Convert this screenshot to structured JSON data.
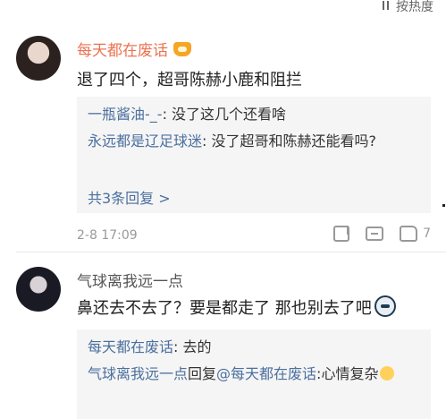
{
  "sort": {
    "label": "按热度"
  },
  "comments": [
    {
      "author": "每天都在废话",
      "text": "退了四个，超哥陈赫小鹿和阻拦",
      "replies": [
        {
          "name": "一瓶酱油-_-",
          "content": ": 没了这几个还看啥"
        },
        {
          "name": "永远都是辽足球迷",
          "content": ": 没了超哥和陈赫还能看吗?"
        }
      ],
      "more_label": "共3条回复 >",
      "time": "2-8 17:09",
      "likes": "7"
    },
    {
      "author": "气球离我远一点",
      "text": "鼻还去不去了？要是都走了 那也别去了吧",
      "replies": [
        {
          "name": "每天都在废话",
          "content": ": 去的"
        },
        {
          "name": "气球离我远一点",
          "mid": "回复",
          "mention": "@每天都在废话",
          "content": ":心情复杂"
        }
      ]
    }
  ],
  "colors": {
    "author_orange": "#eb7350",
    "link_blue": "#4b6f9e",
    "reply_bg": "#f5f5f5"
  }
}
